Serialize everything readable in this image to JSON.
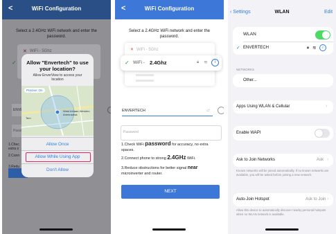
{
  "panel1": {
    "title": "WiFi Configuration",
    "back": "<",
    "instruction": "Select a 2.4GHz WiFi network and enter the password.",
    "network_5g": "WiFi - 5Ghz",
    "input_ssid": "ENVE",
    "input_pw": "Passw",
    "step1": "1.Chec",
    "step1b": "extra s",
    "step2": "2.Conn",
    "step3": "3.Redu",
    "step3b": "microin",
    "dialog": {
      "title": "Allow \"Envertech\" to use your location?",
      "message": "Allow EnverView to access your location",
      "precise": "Precise: On",
      "map_label": "West Inhaan-Western Anenuwesk",
      "map_label2": "Tern",
      "allow_once": "Allow Once",
      "allow_while": "Allow While Using App",
      "dont_allow": "Don't Allow"
    }
  },
  "panel2": {
    "title": "WiFi Configuration",
    "back": "<",
    "instruction": "Select a 2.4GHz WiFi network and enter the password.",
    "network_5g": "WiFi - 5Ghz",
    "network_24g_prefix": "WiFi - ",
    "network_24g_bold": "2.4Ghz",
    "ssid_value": "ENVERTECH",
    "password_placeholder": "Password",
    "step1_pre": "1.Check WiFi ",
    "step1_bold": "password",
    "step1_post": " for accuracy, no extra spaces.",
    "step2_pre": "2.Connect phone to strong ",
    "step2_bold": "2.4GHz",
    "step2_post": " WiFi.",
    "step3_pre": "3.Reduce obstructions for better signal ",
    "step3_bold": "near",
    "step3_post": " microinverter and router.",
    "next": "NEXT"
  },
  "panel3": {
    "back": "Settings",
    "title": "WLAN",
    "edit": "Edit",
    "wlan_label": "WLAN",
    "wlan_on": true,
    "connected": "ENVERTECH",
    "networks_header": "NETWORKS",
    "other": "Other...",
    "apps_using": "Apps Using WLAN & Cellular",
    "enable_wapi": "Enable WAPI",
    "wapi_on": false,
    "ask_join": "Ask to Join Networks",
    "ask_join_value": "Ask",
    "ask_join_desc": "Known networks will be joined automatically. If no known networks are available, you will be asked before joining a new network.",
    "auto_join": "Auto-Join Hotspot",
    "auto_join_value": "Ask to Join",
    "auto_join_desc": "Allow this device to automatically discover nearby personal hotspots when no WLAN network is available."
  },
  "colors": {
    "accent": "#3d78d8",
    "highlight": "#e0245e",
    "green": "#4cd964"
  }
}
